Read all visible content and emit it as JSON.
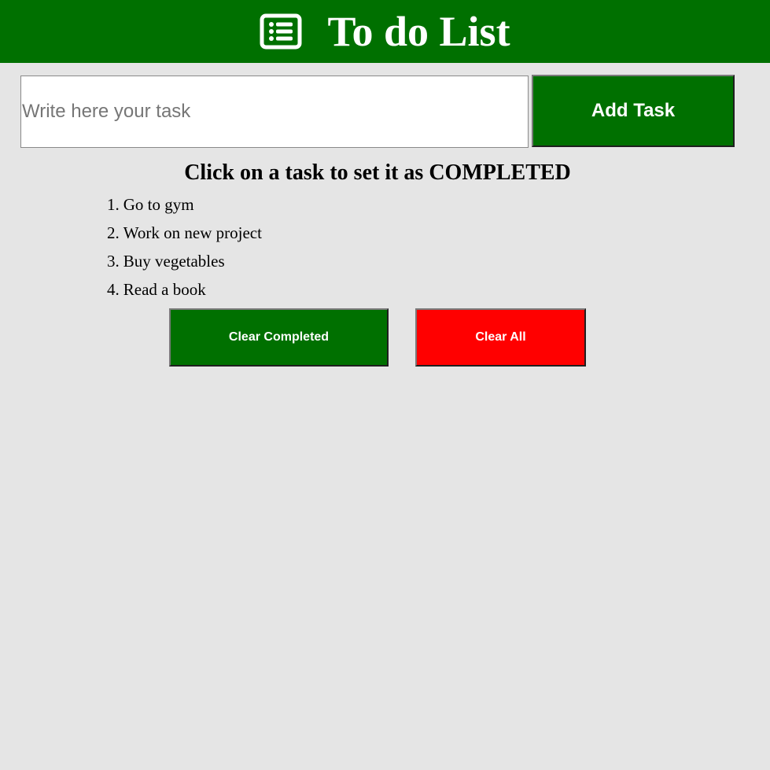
{
  "header": {
    "icon": "list-icon",
    "title": "To do List",
    "color": "#007000"
  },
  "task_input": {
    "placeholder": "Write here your task",
    "value": ""
  },
  "add_button": {
    "label": "Add Task"
  },
  "instructions": "Click on a task to set it as COMPLETED",
  "tasks": [
    {
      "number": "1.",
      "label": "Go to gym"
    },
    {
      "number": "2.",
      "label": "Work on new project"
    },
    {
      "number": "3.",
      "label": "Buy vegetables"
    },
    {
      "number": "4.",
      "label": "Read a book"
    }
  ],
  "actions": {
    "clear_completed": {
      "label": "Clear Completed",
      "color": "#007000"
    },
    "clear_all": {
      "label": "Clear All",
      "color": "#ff0000"
    }
  }
}
